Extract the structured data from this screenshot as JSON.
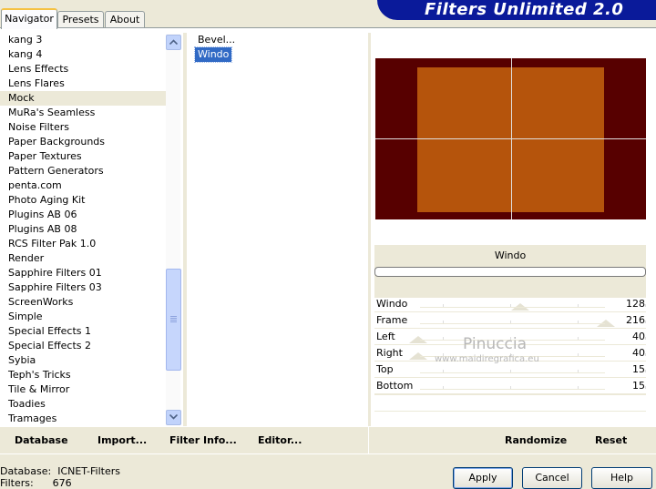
{
  "tabs": [
    {
      "label": "Navigator",
      "active": true
    },
    {
      "label": "Presets",
      "active": false
    },
    {
      "label": "About",
      "active": false
    }
  ],
  "header": {
    "title": "Filters Unlimited 2.0",
    "color": "#0a1a9a"
  },
  "categories": [
    "kang 3",
    "kang 4",
    "Lens Effects",
    "Lens Flares",
    "Mock",
    "MuRa's Seamless",
    "Noise Filters",
    "Paper Backgrounds",
    "Paper Textures",
    "Pattern Generators",
    "penta.com",
    "Photo Aging Kit",
    "Plugins AB 06",
    "Plugins AB 08",
    "RCS Filter Pak 1.0",
    "Render",
    "Sapphire Filters 01",
    "Sapphire Filters 03",
    "ScreenWorks",
    "Simple",
    "Special Effects 1",
    "Special Effects 2",
    "Sybia",
    "Teph's Tricks",
    "Tile & Mirror",
    "Toadies",
    "Tramages"
  ],
  "selected_category": "Mock",
  "filters": [
    "Bevel...",
    "Windo"
  ],
  "selected_filter": "Windo",
  "preview": {
    "outer_color": "#570000",
    "inner_color": "#b5540c"
  },
  "filter_name": "Windo",
  "params": [
    {
      "label": "Windo",
      "value": "128"
    },
    {
      "label": "Frame",
      "value": "216"
    },
    {
      "label": "Left",
      "value": "40"
    },
    {
      "label": "Right",
      "value": "40"
    },
    {
      "label": "Top",
      "value": "15"
    },
    {
      "label": "Bottom",
      "value": "15"
    }
  ],
  "watermark": {
    "name": "Pinuccia",
    "url": "www.maidiregrafica.eu"
  },
  "toolbar": {
    "database": "Database",
    "import": "Import...",
    "filter_info": "Filter Info...",
    "editor": "Editor...",
    "randomize": "Randomize",
    "reset": "Reset"
  },
  "status": {
    "database_label": "Database:",
    "database_value": "ICNET-Filters",
    "filters_label": "Filters:",
    "filters_value": "676"
  },
  "buttons": {
    "apply": "Apply",
    "cancel": "Cancel",
    "help": "Help"
  }
}
